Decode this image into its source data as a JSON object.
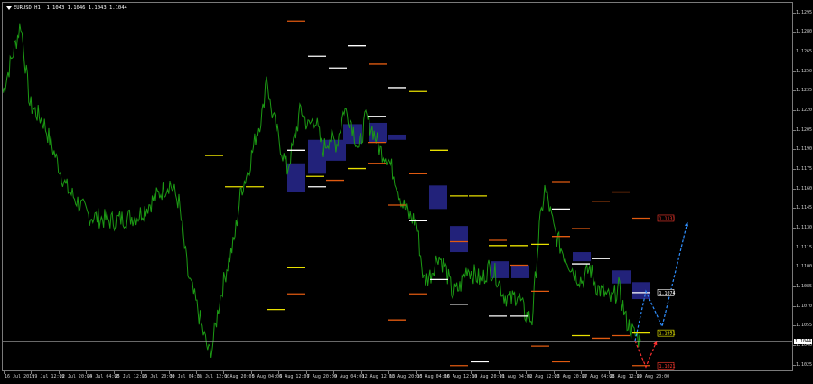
{
  "header": {
    "symbol": "EURUSD,H1",
    "ohlc": "1.1043 1.1046 1.1043 1.1044"
  },
  "price_axis": {
    "labels": [
      "1.1295",
      "1.1280",
      "1.1265",
      "1.1250",
      "1.1235",
      "1.1220",
      "1.1205",
      "1.1190",
      "1.1175",
      "1.1160",
      "1.1145",
      "1.1130",
      "1.1115",
      "1.1100",
      "1.1085",
      "1.1070",
      "1.1055",
      "1.1040",
      "1.1025"
    ],
    "current_price": "1.1044"
  },
  "time_axis": {
    "labels": [
      "16 Jul 2019",
      "19 Jul 12:00",
      "22 Jul 20:00",
      "24 Jul 04:00",
      "25 Jul 12:00",
      "26 Jul 20:00",
      "30 Jul 04:00",
      "31 Jul 12:00",
      "1 Aug 20:00",
      "5 Aug 04:00",
      "6 Aug 12:00",
      "7 Aug 20:00",
      "9 Aug 04:00",
      "12 Aug 12:00",
      "13 Aug 20:00",
      "15 Aug 04:00",
      "16 Aug 12:00",
      "19 Aug 20:00",
      "21 Aug 04:00",
      "22 Aug 12:00",
      "23 Aug 20:00",
      "27 Aug 04:00",
      "28 Aug 12:00",
      "29 Aug 20:00"
    ]
  },
  "price_tags": [
    {
      "text": "1.1131",
      "color": "#ff3b2f",
      "price": 1.1138,
      "time_index": 720
    },
    {
      "text": "1.1074",
      "color": "#ffffff",
      "price": 1.1081,
      "time_index": 720
    },
    {
      "text": "1.1051",
      "color": "#ffff00",
      "price": 1.105,
      "time_index": 720
    },
    {
      "text": "1.1021",
      "color": "#ff3b2f",
      "price": 1.1025,
      "time_index": 720
    }
  ],
  "colors": {
    "background": "#000000",
    "price_line": "#1c9a14",
    "zone_fill": "#22227a",
    "level_white": "#ffffff",
    "level_yellow": "#e8e000",
    "level_orange": "#e05a10",
    "forecast_blue": "#2f8fff",
    "forecast_red": "#ff3030",
    "bid_line": "#a8a8a8"
  },
  "chart_data": {
    "type": "line",
    "symbol": "EURUSD",
    "timeframe": "H1",
    "y_range": [
      1.102,
      1.1303
    ],
    "current_price": 1.1044,
    "price_series": {
      "x": [
        0,
        20,
        30,
        45,
        70,
        95,
        120,
        150,
        175,
        185,
        195,
        205,
        215,
        222,
        228,
        232,
        240,
        248,
        256,
        264,
        272,
        280,
        288,
        292,
        296,
        305,
        315,
        322,
        330,
        338,
        346,
        354,
        362,
        370,
        378,
        386,
        394,
        402,
        410,
        418,
        426,
        434,
        442,
        450,
        458,
        466,
        474,
        482,
        490,
        498,
        506,
        514,
        522,
        530,
        538,
        546,
        554,
        562,
        570,
        578,
        586,
        594,
        600,
        604,
        610,
        618,
        626,
        634,
        642,
        650,
        658,
        666,
        674,
        682,
        690,
        698,
        706
      ],
      "y": [
        1.1234,
        1.1287,
        1.1225,
        1.1212,
        1.1162,
        1.114,
        1.1136,
        1.114,
        1.1158,
        1.1165,
        1.115,
        1.1095,
        1.107,
        1.105,
        1.1035,
        1.104,
        1.1075,
        1.11,
        1.112,
        1.116,
        1.1175,
        1.12,
        1.122,
        1.125,
        1.1225,
        1.12,
        1.1175,
        1.1195,
        1.1222,
        1.1208,
        1.1215,
        1.119,
        1.12,
        1.1195,
        1.1222,
        1.1212,
        1.119,
        1.1215,
        1.1205,
        1.119,
        1.1185,
        1.117,
        1.115,
        1.114,
        1.1135,
        1.109,
        1.1095,
        1.111,
        1.11,
        1.108,
        1.1085,
        1.11,
        1.1095,
        1.109,
        1.11,
        1.1095,
        1.108,
        1.1075,
        1.108,
        1.1065,
        1.106,
        1.113,
        1.116,
        1.115,
        1.113,
        1.1115,
        1.1105,
        1.1095,
        1.109,
        1.11,
        1.1085,
        1.108,
        1.1075,
        1.1085,
        1.106,
        1.105,
        1.1044
      ]
    },
    "zones": [
      {
        "x0": 315,
        "x1": 335,
        "top": 1.118,
        "bottom": 1.1158
      },
      {
        "x0": 338,
        "x1": 358,
        "top": 1.1198,
        "bottom": 1.1172
      },
      {
        "x0": 358,
        "x1": 380,
        "top": 1.1198,
        "bottom": 1.1182
      },
      {
        "x0": 377,
        "x1": 398,
        "top": 1.121,
        "bottom": 1.1195
      },
      {
        "x0": 405,
        "x1": 425,
        "top": 1.1211,
        "bottom": 1.1196
      },
      {
        "x0": 427,
        "x1": 447,
        "top": 1.1202,
        "bottom": 1.1198
      },
      {
        "x0": 472,
        "x1": 492,
        "top": 1.1163,
        "bottom": 1.1145
      },
      {
        "x0": 495,
        "x1": 515,
        "top": 1.1132,
        "bottom": 1.1112
      },
      {
        "x0": 540,
        "x1": 560,
        "top": 1.1105,
        "bottom": 1.1092
      },
      {
        "x0": 563,
        "x1": 583,
        "top": 1.1102,
        "bottom": 1.1092
      },
      {
        "x0": 631,
        "x1": 651,
        "top": 1.1112,
        "bottom": 1.1105
      },
      {
        "x0": 675,
        "x1": 695,
        "top": 1.1098,
        "bottom": 1.1088
      },
      {
        "x0": 697,
        "x1": 717,
        "top": 1.1089,
        "bottom": 1.1076
      }
    ],
    "levels": [
      {
        "x0": 315,
        "x1": 335,
        "price": 1.1289,
        "color": "orange"
      },
      {
        "x0": 338,
        "x1": 358,
        "price": 1.1262,
        "color": "white"
      },
      {
        "x0": 361,
        "x1": 381,
        "price": 1.1253,
        "color": "white"
      },
      {
        "x0": 382,
        "x1": 402,
        "price": 1.127,
        "color": "white"
      },
      {
        "x0": 405,
        "x1": 425,
        "price": 1.1256,
        "color": "orange"
      },
      {
        "x0": 427,
        "x1": 447,
        "price": 1.1238,
        "color": "white"
      },
      {
        "x0": 450,
        "x1": 470,
        "price": 1.1235,
        "color": "yellow"
      },
      {
        "x0": 473,
        "x1": 493,
        "price": 1.119,
        "color": "yellow"
      },
      {
        "x0": 224,
        "x1": 244,
        "price": 1.1186,
        "color": "yellow"
      },
      {
        "x0": 246,
        "x1": 266,
        "price": 1.1162,
        "color": "yellow"
      },
      {
        "x0": 269,
        "x1": 289,
        "price": 1.1162,
        "color": "yellow"
      },
      {
        "x0": 315,
        "x1": 335,
        "price": 1.119,
        "color": "white"
      },
      {
        "x0": 336,
        "x1": 356,
        "price": 1.117,
        "color": "yellow"
      },
      {
        "x0": 358,
        "x1": 378,
        "price": 1.1167,
        "color": "orange"
      },
      {
        "x0": 315,
        "x1": 335,
        "price": 1.11,
        "color": "yellow"
      },
      {
        "x0": 315,
        "x1": 335,
        "price": 1.108,
        "color": "orange"
      },
      {
        "x0": 293,
        "x1": 313,
        "price": 1.1068,
        "color": "yellow"
      },
      {
        "x0": 338,
        "x1": 358,
        "price": 1.1162,
        "color": "white"
      },
      {
        "x0": 404,
        "x1": 424,
        "price": 1.1216,
        "color": "white"
      },
      {
        "x0": 404,
        "x1": 424,
        "price": 1.1196,
        "color": "orange"
      },
      {
        "x0": 404,
        "x1": 424,
        "price": 1.118,
        "color": "orange"
      },
      {
        "x0": 382,
        "x1": 402,
        "price": 1.1176,
        "color": "yellow"
      },
      {
        "x0": 426,
        "x1": 446,
        "price": 1.1148,
        "color": "orange"
      },
      {
        "x0": 450,
        "x1": 470,
        "price": 1.1172,
        "color": "orange"
      },
      {
        "x0": 450,
        "x1": 470,
        "price": 1.1136,
        "color": "white"
      },
      {
        "x0": 450,
        "x1": 470,
        "price": 1.108,
        "color": "orange"
      },
      {
        "x0": 427,
        "x1": 447,
        "price": 1.106,
        "color": "orange"
      },
      {
        "x0": 473,
        "x1": 493,
        "price": 1.1091,
        "color": "white"
      },
      {
        "x0": 495,
        "x1": 515,
        "price": 1.1155,
        "color": "yellow"
      },
      {
        "x0": 516,
        "x1": 536,
        "price": 1.1155,
        "color": "yellow"
      },
      {
        "x0": 495,
        "x1": 515,
        "price": 1.112,
        "color": "orange"
      },
      {
        "x0": 495,
        "x1": 515,
        "price": 1.1072,
        "color": "white"
      },
      {
        "x0": 538,
        "x1": 558,
        "price": 1.1121,
        "color": "orange"
      },
      {
        "x0": 538,
        "x1": 558,
        "price": 1.1117,
        "color": "yellow"
      },
      {
        "x0": 538,
        "x1": 558,
        "price": 1.1063,
        "color": "white"
      },
      {
        "x0": 562,
        "x1": 582,
        "price": 1.1117,
        "color": "yellow"
      },
      {
        "x0": 562,
        "x1": 582,
        "price": 1.1102,
        "color": "orange"
      },
      {
        "x0": 562,
        "x1": 582,
        "price": 1.1063,
        "color": "white"
      },
      {
        "x0": 585,
        "x1": 605,
        "price": 1.1118,
        "color": "yellow"
      },
      {
        "x0": 585,
        "x1": 605,
        "price": 1.1082,
        "color": "orange"
      },
      {
        "x0": 585,
        "x1": 605,
        "price": 1.104,
        "color": "orange"
      },
      {
        "x0": 608,
        "x1": 628,
        "price": 1.1166,
        "color": "orange"
      },
      {
        "x0": 608,
        "x1": 628,
        "price": 1.1145,
        "color": "white"
      },
      {
        "x0": 608,
        "x1": 628,
        "price": 1.1124,
        "color": "orange"
      },
      {
        "x0": 630,
        "x1": 650,
        "price": 1.113,
        "color": "orange"
      },
      {
        "x0": 630,
        "x1": 650,
        "price": 1.1103,
        "color": "white"
      },
      {
        "x0": 630,
        "x1": 650,
        "price": 1.1048,
        "color": "yellow"
      },
      {
        "x0": 652,
        "x1": 672,
        "price": 1.1151,
        "color": "orange"
      },
      {
        "x0": 652,
        "x1": 672,
        "price": 1.1107,
        "color": "white"
      },
      {
        "x0": 652,
        "x1": 672,
        "price": 1.1046,
        "color": "orange"
      },
      {
        "x0": 674,
        "x1": 694,
        "price": 1.1158,
        "color": "orange"
      },
      {
        "x0": 674,
        "x1": 694,
        "price": 1.1048,
        "color": "orange"
      },
      {
        "x0": 697,
        "x1": 717,
        "price": 1.1138,
        "color": "orange"
      },
      {
        "x0": 697,
        "x1": 717,
        "price": 1.1081,
        "color": "white"
      },
      {
        "x0": 697,
        "x1": 717,
        "price": 1.105,
        "color": "yellow"
      },
      {
        "x0": 697,
        "x1": 717,
        "price": 1.1025,
        "color": "orange"
      },
      {
        "x0": 495,
        "x1": 515,
        "price": 1.1025,
        "color": "orange"
      },
      {
        "x0": 518,
        "x1": 538,
        "price": 1.1028,
        "color": "white"
      },
      {
        "x0": 608,
        "x1": 628,
        "price": 1.1028,
        "color": "orange"
      }
    ],
    "forecast_paths": [
      {
        "color": "blue",
        "points": [
          [
            700,
            1.1044
          ],
          [
            712,
            1.1082
          ],
          [
            730,
            1.1055
          ],
          [
            758,
            1.1135
          ]
        ]
      },
      {
        "color": "red",
        "points": [
          [
            700,
            1.1044
          ],
          [
            712,
            1.1024
          ],
          [
            724,
            1.1044
          ]
        ]
      }
    ]
  }
}
